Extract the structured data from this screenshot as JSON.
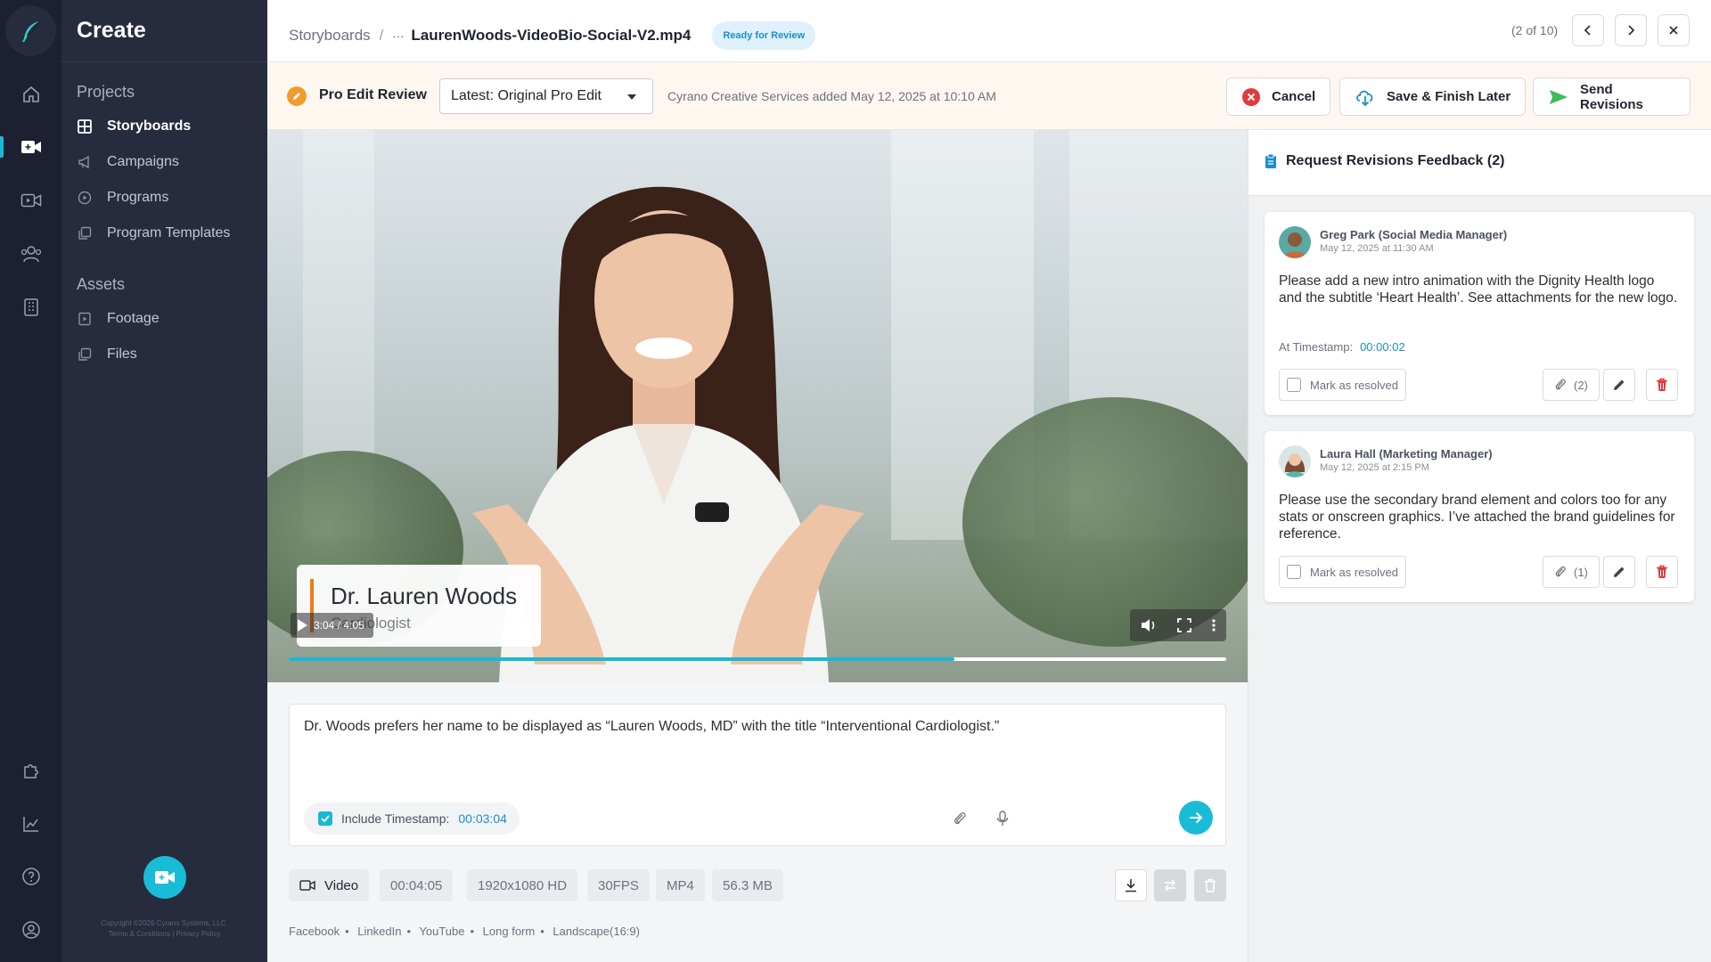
{
  "sidebar": {
    "title": "Create",
    "section_projects": "Projects",
    "section_assets": "Assets",
    "items": [
      {
        "label": "Storyboards"
      },
      {
        "label": "Campaigns"
      },
      {
        "label": "Programs"
      },
      {
        "label": "Program Templates"
      },
      {
        "label": "Footage"
      },
      {
        "label": "Files"
      }
    ],
    "copyright": "Copyright ©2026 Cyrano Systems, LLC.",
    "legal": "Terms & Conditions | Privacy Policy"
  },
  "header": {
    "breadcrumb_root": "Storyboards",
    "breadcrumb_sep": "/",
    "file_menu": "···",
    "file_name": "LaurenWoods-VideoBio-Social-V2.mp4",
    "status_badge": "Ready for Review",
    "pager": "(2 of 10)"
  },
  "review_bar": {
    "title": "Pro Edit Review",
    "version_select": "Latest: Original Pro Edit",
    "note": "Cyrano Creative Services added May 12, 2025 at 10:10 AM",
    "cancel_label": "Cancel",
    "save_label": "Save & Finish Later",
    "send_label": "Send Revisions"
  },
  "video": {
    "lower_third_name": "Dr. Lauren Woods",
    "lower_third_title": "Cardiologist",
    "time_display": "3:04 / 4:05",
    "progress": 0.71
  },
  "comment": {
    "text": "Dr. Woods prefers her name to be displayed as “Lauren Woods, MD” with the title “Interventional Cardiologist.”",
    "include_timestamp_label": "Include Timestamp:",
    "timestamp": "00:03:04",
    "include_timestamp_checked": true
  },
  "meta": {
    "type": "Video",
    "duration": "00:04:05",
    "resolution": "1920x1080 HD",
    "fps": "30FPS",
    "format": "MP4",
    "size": "56.3 MB"
  },
  "tags": [
    "Facebook",
    "LinkedIn",
    "YouTube",
    "Long form",
    "Landscape(16:9)"
  ],
  "feedback": {
    "title": "Request Revisions Feedback (2)",
    "items": [
      {
        "name": "Greg Park (Social Media Manager)",
        "date": "May 12, 2025 at 11:30 AM",
        "body": "Please add a new intro animation with the Dignity Health logo and the subtitle ‘Heart Health’. See attachments for the new logo.",
        "timestamp_label": "At Timestamp:",
        "timestamp": "00:00:02",
        "resolve_label": "Mark as resolved",
        "attachments": "(2)"
      },
      {
        "name": "Laura Hall (Marketing Manager)",
        "date": "May 12, 2025 at 2:15 PM",
        "body": "Please use the secondary brand element and colors too for any stats or onscreen graphics. I’ve attached the brand guidelines for reference.",
        "resolve_label": "Mark as resolved",
        "attachments": "(1)"
      }
    ]
  },
  "colors": {
    "accent": "#19bcd6",
    "rail_bg": "#1c2030",
    "sidebar_bg": "#262b3d",
    "danger": "#e03a3a",
    "warning": "#f29c2b"
  }
}
